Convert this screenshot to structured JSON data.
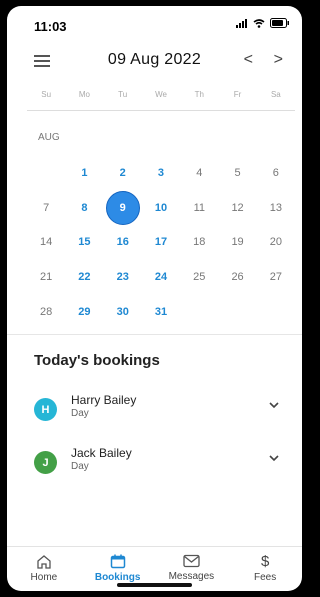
{
  "status_bar": {
    "time": "11:03"
  },
  "header": {
    "title": "09 Aug 2022",
    "prev": "<",
    "next": ">"
  },
  "calendar": {
    "weekdays": [
      "Su",
      "Mo",
      "Tu",
      "We",
      "Th",
      "Fr",
      "Sa"
    ],
    "month_label": "AUG",
    "weeks": [
      [
        {
          "d": ""
        },
        {
          "d": "1",
          "s": "avail"
        },
        {
          "d": "2",
          "s": "avail"
        },
        {
          "d": "3",
          "s": "avail"
        },
        {
          "d": "4"
        },
        {
          "d": "5"
        },
        {
          "d": "6"
        }
      ],
      [
        {
          "d": "7"
        },
        {
          "d": "8",
          "s": "avail"
        },
        {
          "d": "9",
          "s": "sel"
        },
        {
          "d": "10",
          "s": "avail"
        },
        {
          "d": "11"
        },
        {
          "d": "12"
        },
        {
          "d": "13"
        }
      ],
      [
        {
          "d": "14"
        },
        {
          "d": "15",
          "s": "avail"
        },
        {
          "d": "16",
          "s": "avail"
        },
        {
          "d": "17",
          "s": "avail"
        },
        {
          "d": "18"
        },
        {
          "d": "19"
        },
        {
          "d": "20"
        }
      ],
      [
        {
          "d": "21"
        },
        {
          "d": "22",
          "s": "avail"
        },
        {
          "d": "23",
          "s": "avail"
        },
        {
          "d": "24",
          "s": "avail"
        },
        {
          "d": "25"
        },
        {
          "d": "26"
        },
        {
          "d": "27"
        }
      ],
      [
        {
          "d": "28"
        },
        {
          "d": "29",
          "s": "avail"
        },
        {
          "d": "30",
          "s": "avail"
        },
        {
          "d": "31",
          "s": "avail"
        },
        {
          "d": ""
        },
        {
          "d": ""
        },
        {
          "d": ""
        }
      ]
    ]
  },
  "bookings": {
    "title": "Today's bookings",
    "items": [
      {
        "initial": "H",
        "name": "Harry Bailey",
        "type": "Day",
        "color": "#26b6d6"
      },
      {
        "initial": "J",
        "name": "Jack Bailey",
        "type": "Day",
        "color": "#43a047"
      }
    ]
  },
  "tabs": [
    {
      "label": "Home",
      "icon": "home-icon"
    },
    {
      "label": "Bookings",
      "icon": "calendar-icon",
      "active": true
    },
    {
      "label": "Messages",
      "icon": "mail-icon"
    },
    {
      "label": "Fees",
      "icon": "dollar-icon"
    }
  ],
  "colors": {
    "accent": "#1e88d2",
    "selected": "#2d8be6"
  }
}
